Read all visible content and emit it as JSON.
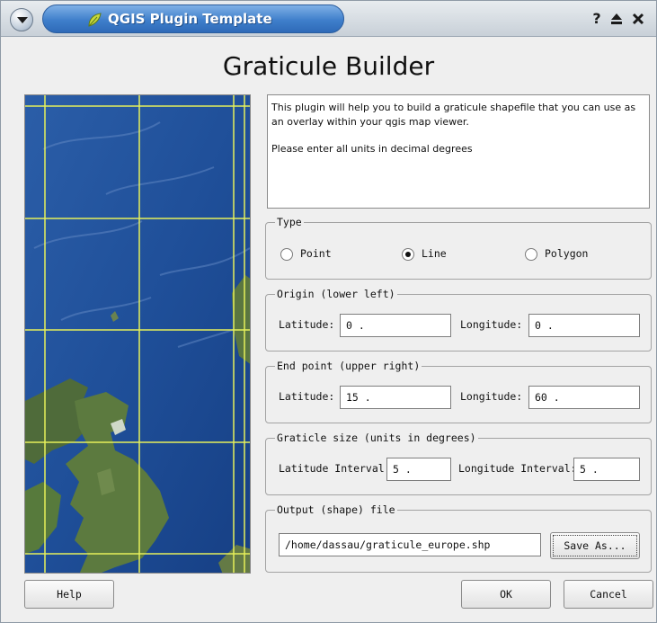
{
  "window": {
    "title": "QGIS Plugin Template",
    "controls": [
      "question-mark-icon",
      "maximize-icon",
      "close-icon"
    ]
  },
  "dialog": {
    "heading": "Graticule Builder",
    "description_line1": "This plugin will help you to build a graticule shapefile that you can use as an overlay within your qgis map viewer.",
    "description_line2": "Please enter all units in decimal degrees"
  },
  "type_group": {
    "title": "Type",
    "options": [
      "Point",
      "Line",
      "Polygon"
    ],
    "selected": "Line"
  },
  "origin_group": {
    "title": "Origin (lower left)",
    "latitude_label": "Latitude:",
    "latitude_value": "0 .",
    "longitude_label": "Longitude:",
    "longitude_value": "0 ."
  },
  "endpoint_group": {
    "title": "End point (upper right)",
    "latitude_label": "Latitude:",
    "latitude_value": "15 .",
    "longitude_label": "Longitude:",
    "longitude_value": "60 ."
  },
  "size_group": {
    "title": "Graticle size (units in degrees)",
    "lat_interval_label": "Latitude Interval:",
    "lat_interval_value": "5 .",
    "lon_interval_label": "Longitude Interval:",
    "lon_interval_value": "5 ."
  },
  "output_group": {
    "title": "Output (shape) file",
    "path": "/home/dassau/graticule_europe.shp",
    "save_as_label": "Save As..."
  },
  "buttons": {
    "help": "Help",
    "ok": "OK",
    "cancel": "Cancel"
  },
  "colors": {
    "title_accent": "#3f7fcb",
    "graticule_line": "#e6f05a",
    "ocean": "#1e4d96"
  }
}
